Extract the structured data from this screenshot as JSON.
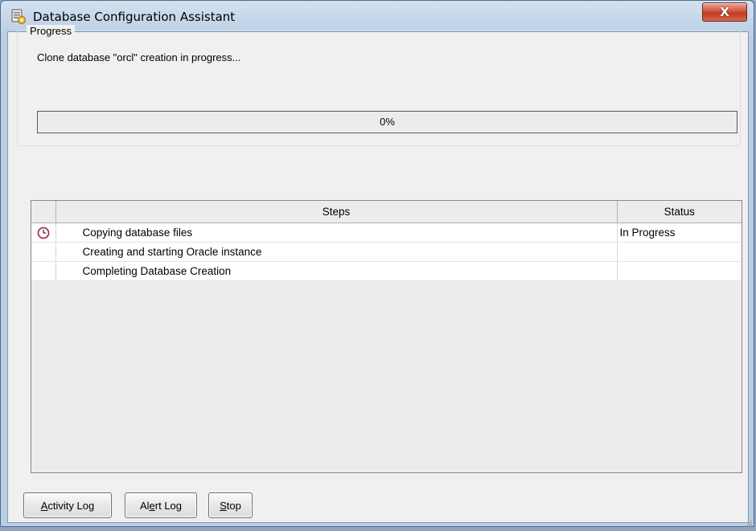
{
  "window": {
    "title": "Database Configuration Assistant",
    "close_label": "X"
  },
  "progress": {
    "group_label": "Progress",
    "message": "Clone database \"orcl\" creation in progress...",
    "percent": 0,
    "percent_label": "0%"
  },
  "steps_table": {
    "columns": {
      "steps": "Steps",
      "status": "Status"
    },
    "rows": [
      {
        "step": "Copying database files",
        "status": "In Progress",
        "icon": "clock-icon"
      },
      {
        "step": "Creating and starting Oracle instance",
        "status": "",
        "icon": ""
      },
      {
        "step": "Completing Database Creation",
        "status": "",
        "icon": ""
      }
    ]
  },
  "buttons": {
    "activity_log": {
      "pre": "",
      "mn": "A",
      "post": "ctivity Log"
    },
    "alert_log": {
      "pre": "Al",
      "mn": "e",
      "post": "rt Log"
    },
    "stop": {
      "pre": "",
      "mn": "S",
      "post": "top"
    }
  },
  "colors": {
    "title_bar": "#c2d4e8",
    "close_button": "#c23a22",
    "client_background": "#f0f0f0",
    "progress_fill": "#3f6fbf"
  }
}
